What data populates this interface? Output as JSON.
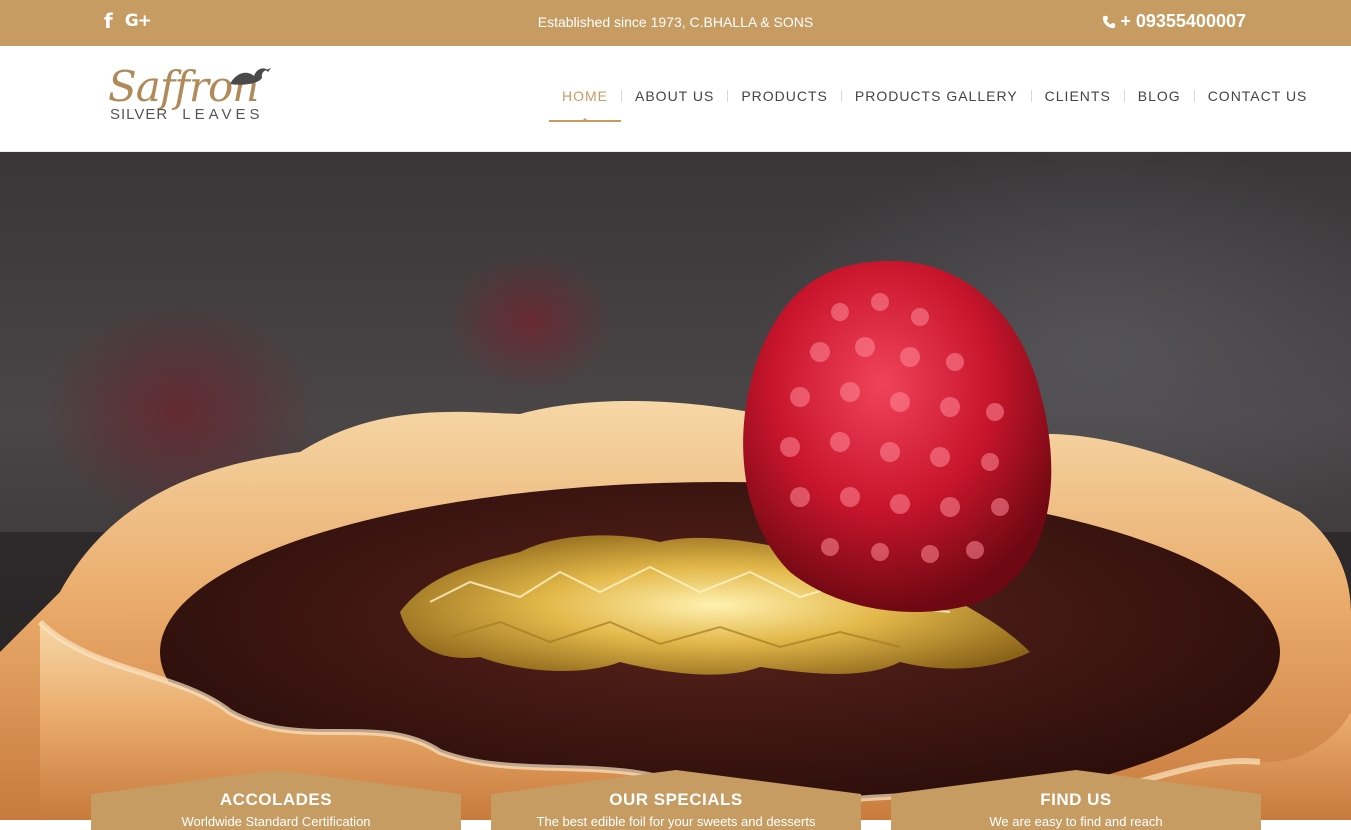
{
  "topbar": {
    "tagline": "Established since 1973, C.BHALLA & SONS",
    "phone": "+ 09355400007",
    "social": [
      {
        "icon": "facebook-icon",
        "glyph": "f"
      },
      {
        "icon": "google-plus-icon",
        "glyph": "G+"
      }
    ],
    "bg_color": "#c69c62"
  },
  "logo": {
    "script_text": "Saffron",
    "sub_left": "SILVER",
    "sub_right": "LEAVES"
  },
  "nav": {
    "items": [
      {
        "label": "HOME",
        "active": true
      },
      {
        "label": "ABOUT US",
        "active": false
      },
      {
        "label": "PRODUCTS",
        "active": false
      },
      {
        "label": "PRODUCTS GALLERY",
        "active": false
      },
      {
        "label": "CLIENTS",
        "active": false
      },
      {
        "label": "BLOG",
        "active": false
      },
      {
        "label": "CONTACT US",
        "active": false
      }
    ],
    "accent_color": "#c69c62"
  },
  "hero": {
    "image": "raspberry-gold-leaf-tart"
  },
  "features": [
    {
      "title": "ACCOLADES",
      "text": "Worldwide Standard Certification"
    },
    {
      "title": "OUR SPECIALS",
      "text": "The best edible foil for your sweets and desserts"
    },
    {
      "title": "FIND US",
      "text": "We are easy to find and reach"
    }
  ]
}
